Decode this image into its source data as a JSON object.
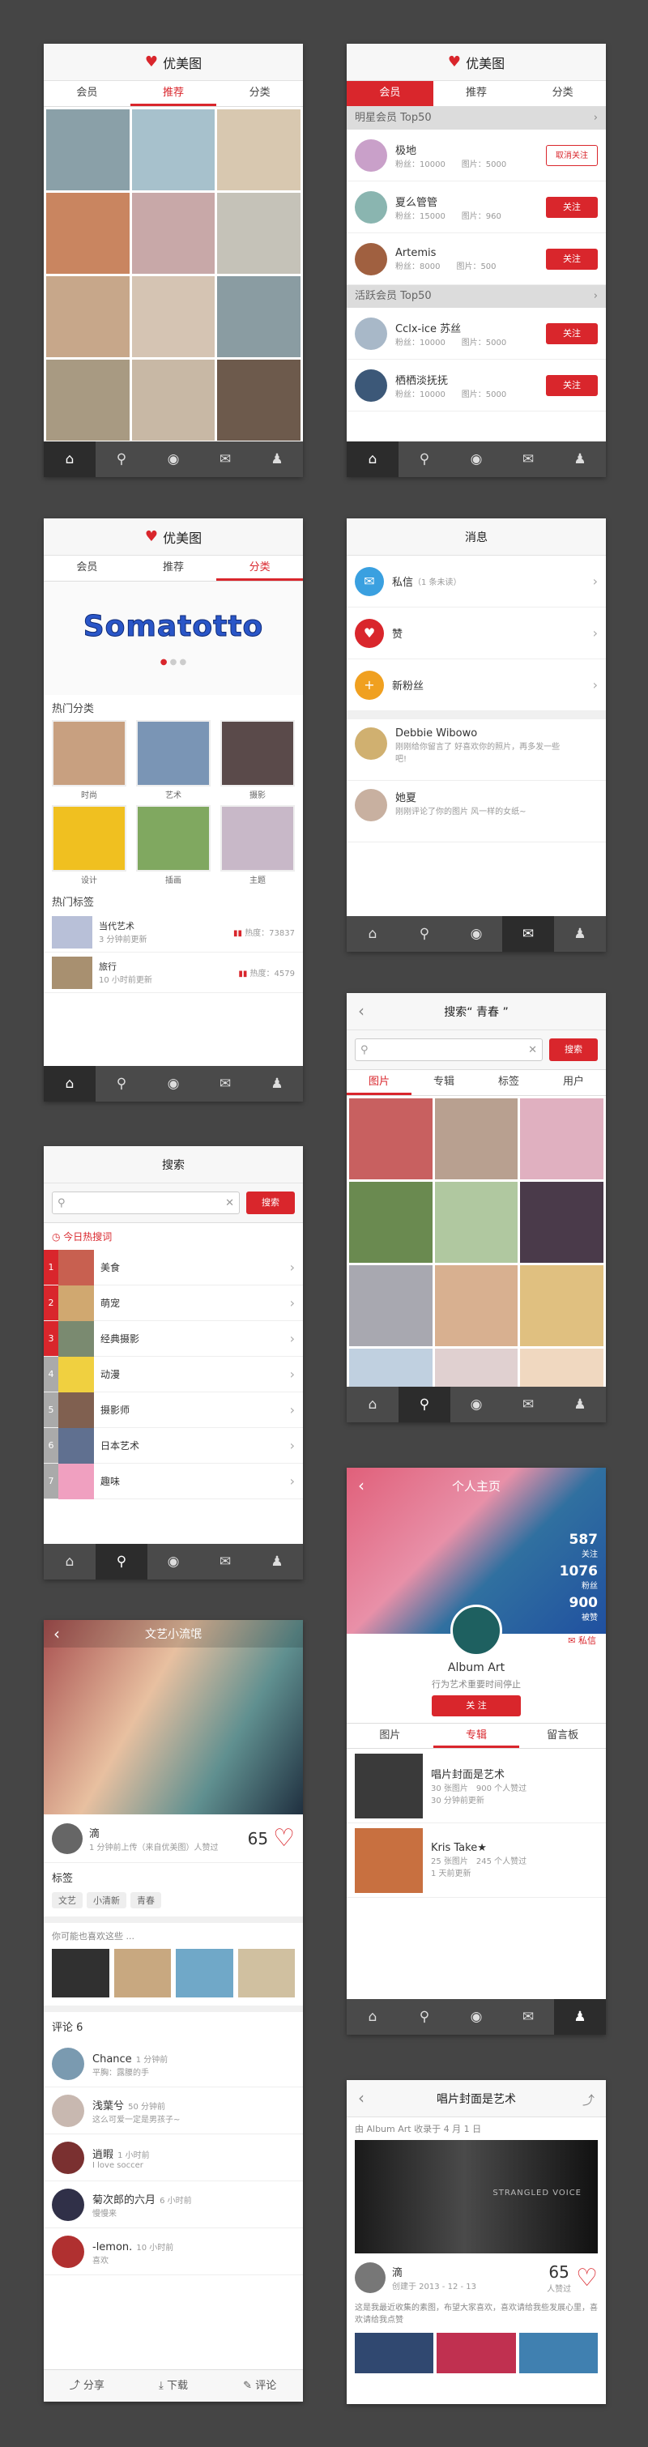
{
  "s1": {
    "title": "优美图",
    "tabs": [
      "会员",
      "推荐",
      "分类"
    ],
    "photos": [
      "#8aa0a8",
      "#a7c1cc",
      "#d8c8b0",
      "#c98560",
      "#c8a8a8",
      "#c5c2b8",
      "#c7a78a",
      "#d5c4b3",
      "#8a9ca2",
      "#a89a82",
      "#c8b8a5",
      "#6d5a4c"
    ]
  },
  "s2": {
    "title": "优美图",
    "tabs": [
      "会员",
      "推荐",
      "分类"
    ],
    "sec1": "明星会员 Top50",
    "sec2": "活跃会员 Top50",
    "users1": [
      {
        "name": "极地",
        "stats": "粉丝：10000　　图片：5000",
        "btn": "取消关注",
        "col": "#c9a0c9"
      },
      {
        "name": "夏么管管",
        "stats": "粉丝：15000　　图片：960",
        "btn": "关注",
        "col": "#8ab5b0"
      },
      {
        "name": "Artemis",
        "stats": "粉丝：8000　　图片：500",
        "btn": "关注",
        "col": "#a06040"
      }
    ],
    "users2": [
      {
        "name": "Cclx-ice 苏丝",
        "stats": "粉丝：10000　　图片：5000",
        "btn": "关注",
        "col": "#a8b8c8"
      },
      {
        "name": "栖栖淡抚抚",
        "stats": "粉丝：10000　　图片：5000",
        "btn": "关注",
        "col": "#3c5878"
      }
    ]
  },
  "s3": {
    "title": "优美图",
    "tabs": [
      "会员",
      "推荐",
      "分类"
    ],
    "banner": "Somatotto",
    "hot_cat": "热门分类",
    "cats": [
      {
        "label": "时尚",
        "col": "#c8a080"
      },
      {
        "label": "艺术",
        "col": "#7a95b5"
      },
      {
        "label": "摄影",
        "col": "#5a4a4a"
      },
      {
        "label": "设计",
        "col": "#f0c020"
      },
      {
        "label": "插画",
        "col": "#80a860"
      },
      {
        "label": "主题",
        "col": "#c8b8c8"
      }
    ],
    "hot_tags": "热门标签",
    "tags": [
      {
        "name": "当代艺术",
        "time": "3 分钟前更新",
        "heat": "热度：73837",
        "col": "#b8c0d8"
      },
      {
        "name": "旅行",
        "time": "10 小时前更新",
        "heat": "热度：4579",
        "col": "#a89070"
      }
    ]
  },
  "s4": {
    "title": "消息",
    "items": [
      {
        "label": "私信",
        "sub": "（1 条未读）",
        "col": "#3aa0e0",
        "icon": "✉"
      },
      {
        "label": "赞",
        "sub": "",
        "col": "#d9262c",
        "icon": "♥"
      },
      {
        "label": "新粉丝",
        "sub": "",
        "col": "#f0a020",
        "icon": "+"
      }
    ],
    "msgs": [
      {
        "name": "Debbie Wibowo",
        "txt": "刚刚给你留言了 好喜欢你的照片，再多发一些吧!",
        "col": "#d0b070"
      },
      {
        "name": "她夏",
        "txt": "刚刚评论了你的图片 风一样的女纸~",
        "col": "#c8b0a0"
      }
    ]
  },
  "s5": {
    "title": "搜索“ 青春 ”",
    "btn": "搜索",
    "tabs": [
      "图片",
      "专辑",
      "标签",
      "用户"
    ],
    "photos": [
      "#c86060",
      "#b8a090",
      "#e0b0c0",
      "#6a8a50",
      "#b0c8a0",
      "#4a3a4a",
      "#a8a8b0",
      "#d8b090",
      "#e0c080",
      "#c0d0e0",
      "#e0d0d0",
      "#f0d8c0"
    ]
  },
  "s6": {
    "title": "搜索",
    "btn": "搜索",
    "hot": "今日热搜词",
    "items": [
      {
        "n": "1",
        "name": "美食",
        "col": "#c86050"
      },
      {
        "n": "2",
        "name": "萌宠",
        "col": "#d0a870"
      },
      {
        "n": "3",
        "name": "经典摄影",
        "col": "#7a8a70"
      },
      {
        "n": "4",
        "name": "动漫",
        "col": "#f0d040"
      },
      {
        "n": "5",
        "name": "摄影师",
        "col": "#806050"
      },
      {
        "n": "6",
        "name": "日本艺术",
        "col": "#607090"
      },
      {
        "n": "7",
        "name": "趣味",
        "col": "#f0a0c0"
      }
    ]
  },
  "s7": {
    "title": "个人主页",
    "stats": [
      {
        "num": "587",
        "lbl": "关注"
      },
      {
        "num": "1076",
        "lbl": "粉丝"
      },
      {
        "num": "900",
        "lbl": "被赞"
      }
    ],
    "name": "Album Art",
    "desc": "行为艺术重要时间停止",
    "msg": "私信",
    "follow": "关 注",
    "tabs": [
      "图片",
      "专辑",
      "留言板"
    ],
    "albums": [
      {
        "name": "唱片封面是艺术",
        "info": "30 张图片　900 个人赞过",
        "time": "30 分钟前更新",
        "col": "#3a3a3a"
      },
      {
        "name": "Kris Take★",
        "info": "25 张图片　245 个人赞过",
        "time": "1 天前更新",
        "col": "#c87040"
      }
    ]
  },
  "s8": {
    "title": "文艺小流氓",
    "user": "滴",
    "time": "1 分钟前上传（来自优美图）人赞过",
    "likes": "65",
    "tag_title": "标签",
    "tags": [
      "文艺",
      "小清新",
      "青春"
    ],
    "like_hint": "你可能也喜欢这些 ...",
    "sims": [
      "#303030",
      "#c8a880",
      "#70a8c8",
      "#d0c0a0"
    ],
    "comments_title": "评论 6",
    "comments": [
      {
        "name": "Chance",
        "t": "1 分钟前",
        "txt": "平胸：露腰的手",
        "col": "#7a9ab0"
      },
      {
        "name": "浅葉兮",
        "t": "50 分钟前",
        "txt": "这么可爱一定是男孩子~",
        "col": "#c8b8b0"
      },
      {
        "name": "逍暇",
        "t": "1 小时前",
        "txt": "I love soccer",
        "col": "#7a3030"
      },
      {
        "name": "菊次郎的六月",
        "t": "6 小时前",
        "txt": "慢慢来",
        "col": "#303048"
      },
      {
        "name": "-lemon.",
        "t": "10 小时前",
        "txt": "喜欢",
        "col": "#b03030"
      }
    ],
    "bar": [
      "分享",
      "下载",
      "评论"
    ]
  },
  "s9": {
    "title": "唱片封面是艺术",
    "sub": "由 Album Art 收录于 4 月 1 日",
    "user": "滴",
    "time": "创建于 2013 - 12 - 13",
    "likes": "65",
    "likes_lbl": "人赞过",
    "desc": "这是我最近收集的素图，布望大家喜欢，喜欢请给我些发展心里，喜欢请给我点赞",
    "cover_text": "STRANGLED VOICE"
  }
}
